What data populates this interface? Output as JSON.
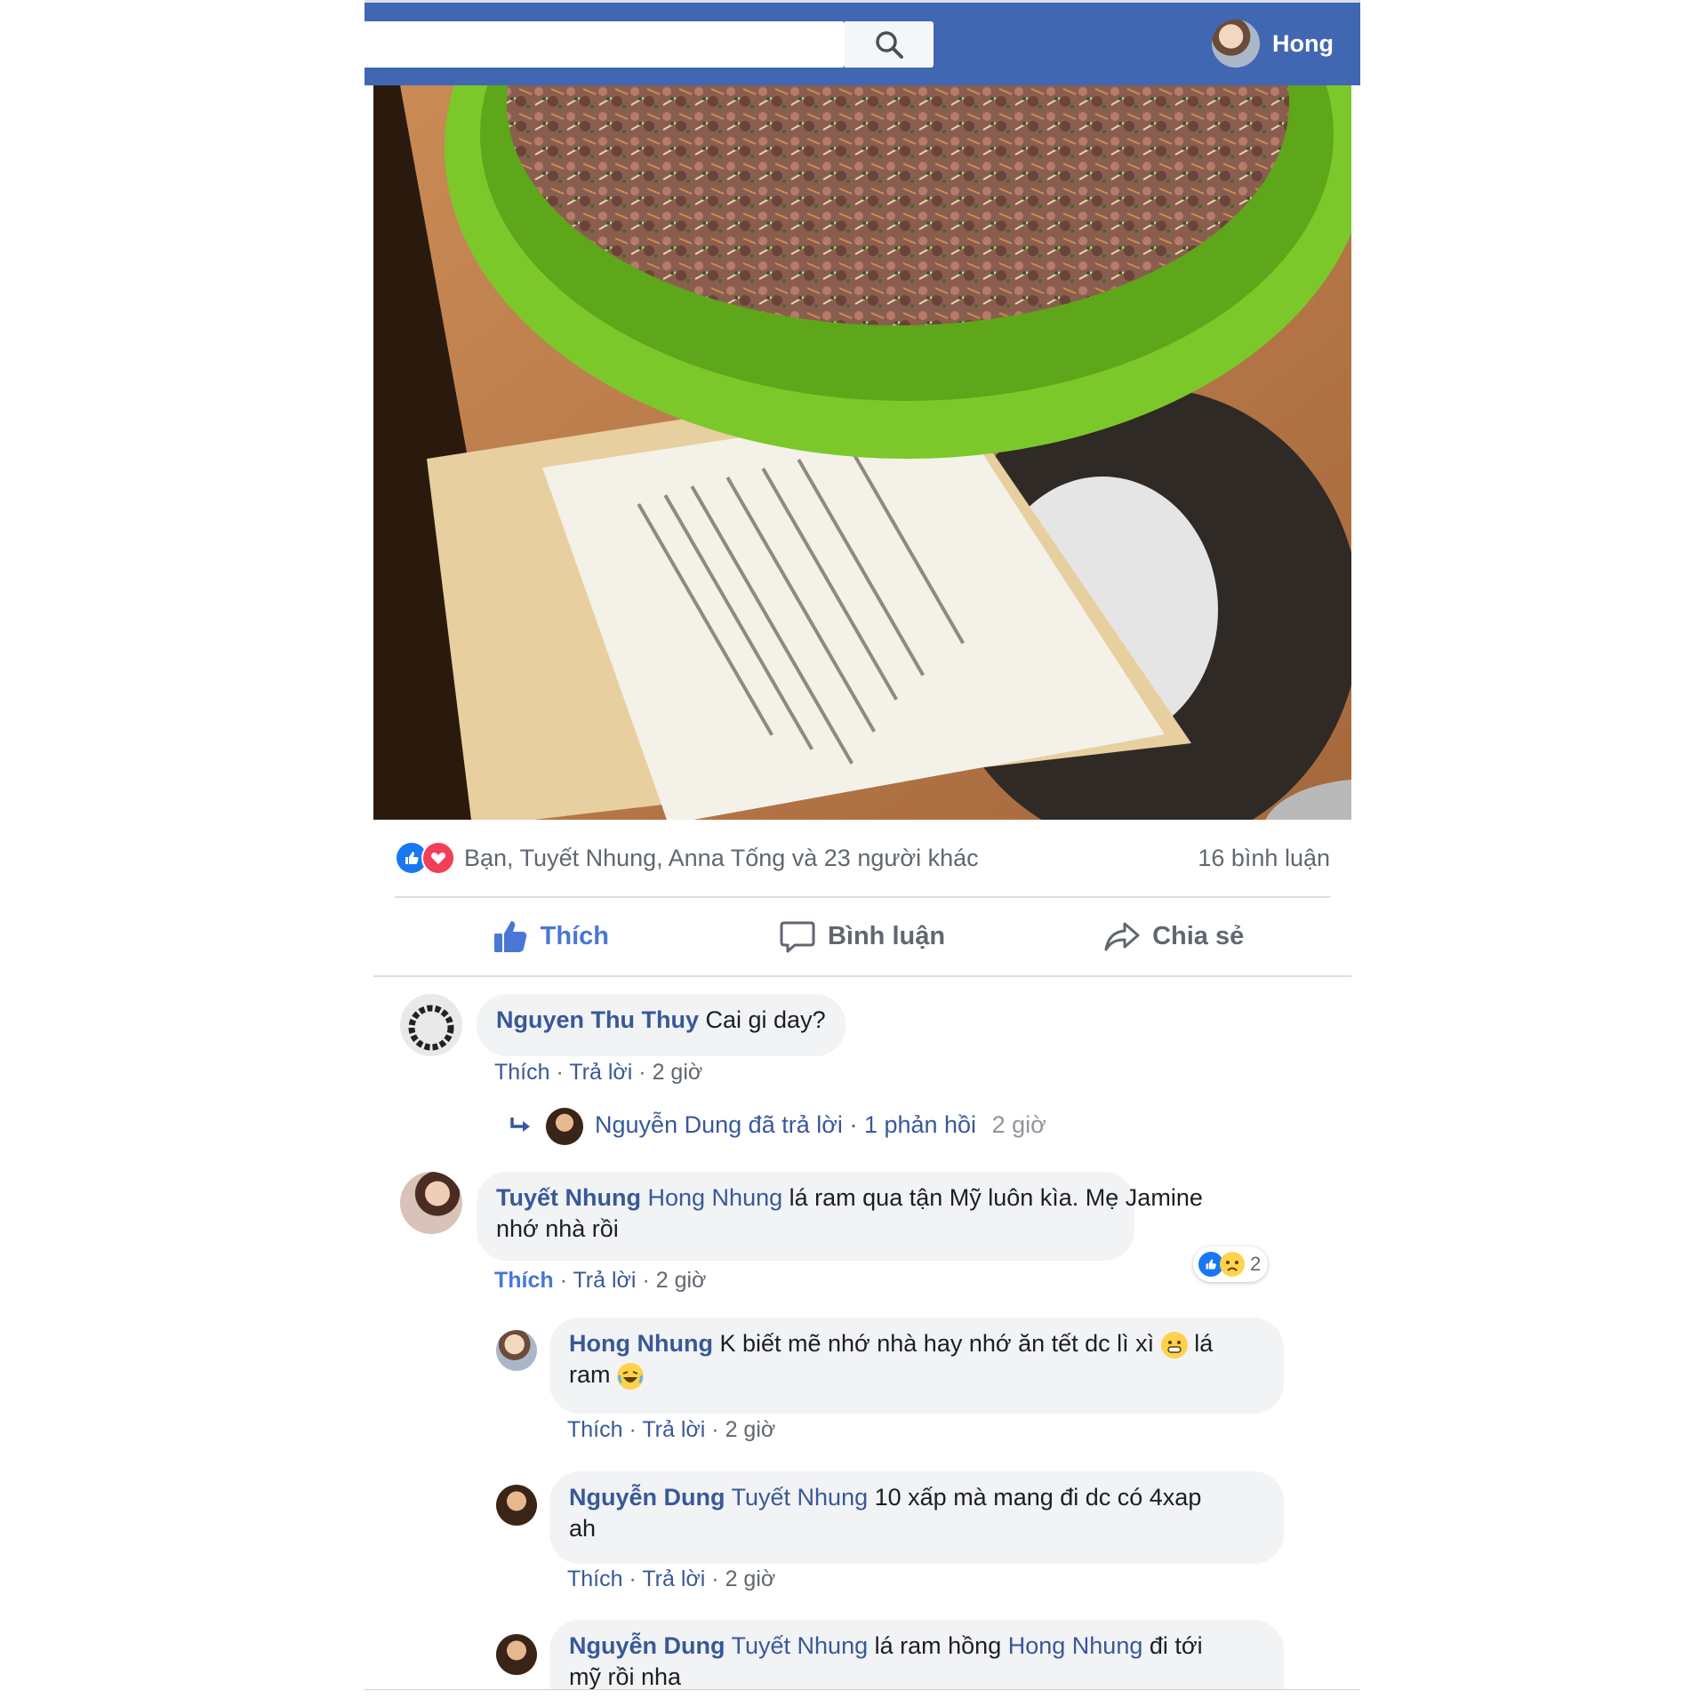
{
  "header": {
    "search_placeholder": "",
    "profile_name": "Hong"
  },
  "post": {
    "reactions_summary": "Bạn, Tuyết Nhung, Anna Tống và 23 người khác",
    "comment_count": "16 bình luận",
    "actions": {
      "like": "Thích",
      "comment": "Bình luận",
      "share": "Chia sẻ"
    }
  },
  "comments": [
    {
      "name": "Nguyen Thu Thuy",
      "text": "Cai gi day?",
      "like": "Thích",
      "reply": "Trả lời",
      "time": "2 giờ",
      "reply_summary": {
        "name": "Nguyễn Dung",
        "action": "đã trả lời",
        "replies": "1 phản hồi",
        "time": "2 giờ"
      }
    },
    {
      "name": "Tuyết Nhung",
      "mention": "Hong Nhung",
      "text_line1": "lá ram qua tận Mỹ luôn kìa. Mẹ Jamine",
      "text_line2": "nhớ nhà rồi",
      "like": "Thích",
      "reply": "Trả lời",
      "time": "2 giờ",
      "reaction_count": "2"
    }
  ],
  "replies": [
    {
      "name": "Hong Nhung",
      "text_line1": "K biết mẽ nhớ nhà hay nhớ ăn tết dc lì xì",
      "text_line1_end": "lá",
      "text_line2": "ram",
      "like": "Thích",
      "reply": "Trả lời",
      "time": "2 giờ"
    },
    {
      "name": "Nguyễn Dung",
      "mention": "Tuyết Nhung",
      "text_line1": "10 xấp mà mang đi dc có 4xap",
      "text_line2": "ah",
      "like": "Thích",
      "reply": "Trả lời",
      "time": "2 giờ"
    },
    {
      "name": "Nguyễn Dung",
      "mention": "Tuyết Nhung",
      "text_mid": "lá ram hồng",
      "mention2": "Hong Nhung",
      "text_end": "đi tới",
      "text_line2": "mỹ rồi nha"
    }
  ],
  "colors": {
    "topbar": "#4267b2",
    "link": "#385898",
    "like_active": "#4a77d6"
  },
  "icons": [
    "search-icon",
    "like-icon",
    "love-icon",
    "comment-icon",
    "share-icon",
    "reply-arrow-icon",
    "sad-icon"
  ]
}
